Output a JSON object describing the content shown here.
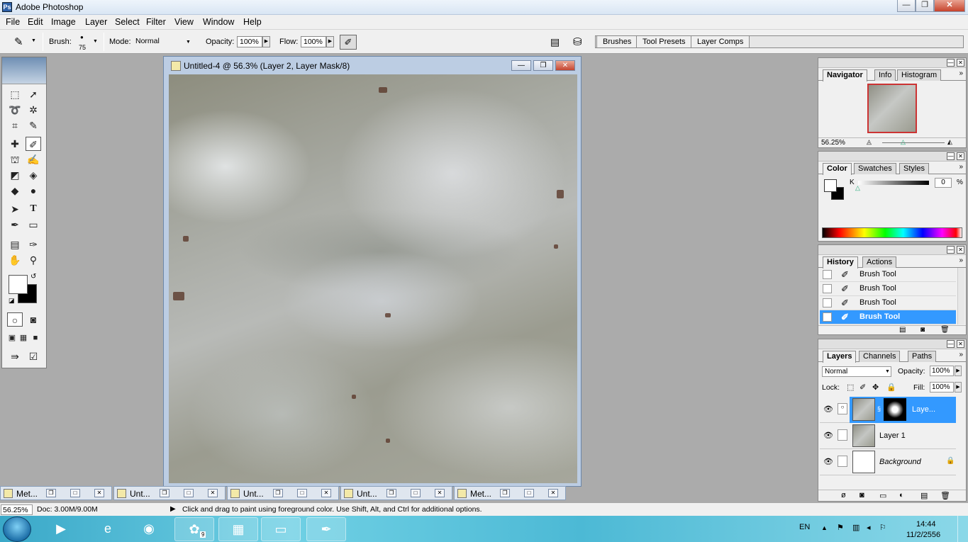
{
  "app": {
    "title": "Adobe Photoshop"
  },
  "window_controls": {
    "minimize": "—",
    "maximize": "❐",
    "close": "✕"
  },
  "menu": [
    "File",
    "Edit",
    "Image",
    "Layer",
    "Select",
    "Filter",
    "View",
    "Window",
    "Help"
  ],
  "options": {
    "brush_label": "Brush:",
    "brush_size": "75",
    "mode_label": "Mode:",
    "mode_value": "Normal",
    "opacity_label": "Opacity:",
    "opacity_value": "100%",
    "flow_label": "Flow:",
    "flow_value": "100%",
    "well_tabs": [
      "Brushes",
      "Tool Presets",
      "Layer Comps"
    ]
  },
  "document": {
    "title": "Untitled-4 @ 56.3% (Layer 2, Layer Mask/8)"
  },
  "navigator": {
    "tabs": [
      "Navigator",
      "Info",
      "Histogram"
    ],
    "zoom": "56.25%"
  },
  "color": {
    "tabs": [
      "Color",
      "Swatches",
      "Styles"
    ],
    "channel": "K",
    "value": "0",
    "unit": "%"
  },
  "history": {
    "tabs": [
      "History",
      "Actions"
    ],
    "items": [
      "Brush Tool",
      "Brush Tool",
      "Brush Tool",
      "Brush Tool"
    ]
  },
  "layers": {
    "tabs": [
      "Layers",
      "Channels",
      "Paths"
    ],
    "blend_mode": "Normal",
    "opacity_label": "Opacity:",
    "opacity_value": "100%",
    "lock_label": "Lock:",
    "fill_label": "Fill:",
    "fill_value": "100%",
    "items": [
      "Laye...",
      "Layer 1",
      "Background"
    ]
  },
  "minimized_docs": [
    "Met...",
    "Unt...",
    "Unt...",
    "Unt...",
    "Met..."
  ],
  "status": {
    "zoom": "56.25%",
    "doc": "Doc: 3.00M/9.00M",
    "message": "Click and drag to paint using foreground color.  Use Shift, Alt, and Ctrl for additional options."
  },
  "taskbar": {
    "lang": "EN",
    "time": "14:44",
    "date": "11/2/2556",
    "badge": "9"
  },
  "colors": {
    "selection": "#3399ff",
    "panel": "#f0f0f0",
    "workspace": "#ababab"
  }
}
